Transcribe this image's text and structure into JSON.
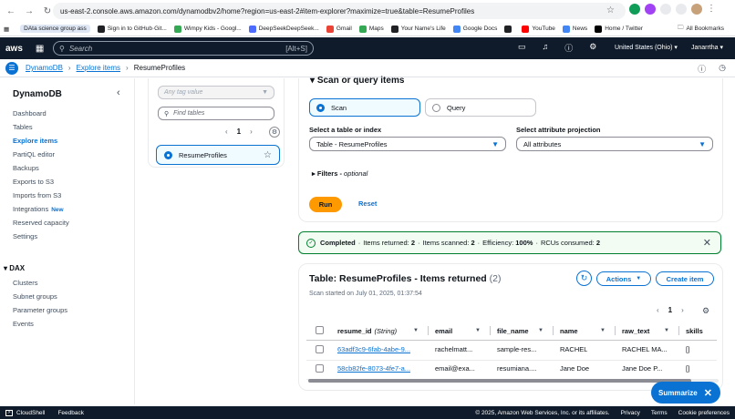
{
  "browser": {
    "url": "us-east-2.console.aws.amazon.com/dynamodbv2/home?region=us-east-2#item-explorer?maximize=true&table=ResumeProfiles",
    "bookmarks": [
      {
        "label": "DAta science group ass",
        "color": "#dfe7f5"
      },
      {
        "label": "Sign in to GitHub·Git...",
        "color": "#202124"
      },
      {
        "label": "Wimpy Kids - Googl...",
        "color": "#34a853"
      },
      {
        "label": "DeepSeekDeepSeek...",
        "color": "#4d6bfe"
      },
      {
        "label": "Gmail",
        "color": "#ea4335"
      },
      {
        "label": "Maps",
        "color": "#34a853"
      },
      {
        "label": "Your Name's Life",
        "color": "#202124"
      },
      {
        "label": "Google Docs",
        "color": "#4285f4"
      },
      {
        "label": "",
        "color": "#202124"
      },
      {
        "label": "YouTube",
        "color": "#ff0000"
      },
      {
        "label": "News",
        "color": "#4285f4"
      },
      {
        "label": "Home / Twitter",
        "color": "#000000"
      }
    ],
    "all_bookmarks": "All Bookmarks"
  },
  "awsnav": {
    "logo": "aws",
    "search_placeholder": "Search",
    "search_shortcut": "[Alt+S]",
    "region": "United States (Ohio) ▾",
    "user": "Janarrtha ▾"
  },
  "breadcrumb": {
    "items": [
      "DynamoDB",
      "Explore items",
      "ResumeProfiles"
    ]
  },
  "sidebar": {
    "title": "DynamoDB",
    "items": [
      {
        "label": "Dashboard",
        "active": false
      },
      {
        "label": "Tables",
        "active": false
      },
      {
        "label": "Explore items",
        "active": true
      },
      {
        "label": "PartiQL editor",
        "active": false
      },
      {
        "label": "Backups",
        "active": false
      },
      {
        "label": "Exports to S3",
        "active": false
      },
      {
        "label": "Imports from S3",
        "active": false
      },
      {
        "label": "Integrations",
        "active": false,
        "badge": "New"
      },
      {
        "label": "Reserved capacity",
        "active": false
      },
      {
        "label": "Settings",
        "active": false
      }
    ],
    "dax_section": "DAX",
    "dax_items": [
      "Clusters",
      "Subnet groups",
      "Parameter groups",
      "Events"
    ]
  },
  "tables_panel": {
    "tag_placeholder": "Any tag value",
    "find_placeholder": "Find tables",
    "page": "1",
    "selected_table": "ResumeProfiles"
  },
  "scan_panel": {
    "title": "Scan or query items",
    "scan_label": "Scan",
    "query_label": "Query",
    "table_label": "Select a table or index",
    "table_value": "Table - ResumeProfiles",
    "projection_label": "Select attribute projection",
    "projection_value": "All attributes",
    "filters_label": "Filters",
    "filters_optional": "optional",
    "run_label": "Run",
    "reset_label": "Reset"
  },
  "flash": {
    "status": "Completed",
    "items_returned_label": "Items returned:",
    "items_returned": "2",
    "items_scanned_label": "Items scanned:",
    "items_scanned": "2",
    "efficiency_label": "Efficiency:",
    "efficiency": "100%",
    "rcus_label": "RCUs consumed:",
    "rcus": "2"
  },
  "items_panel": {
    "title": "Table: ResumeProfiles - Items returned",
    "count": "(2)",
    "subtitle": "Scan started on July 01, 2025, 01:37:54",
    "actions_label": "Actions",
    "create_label": "Create item",
    "page": "1",
    "columns": [
      {
        "key": "resume_id",
        "type": "(String)"
      },
      {
        "key": "email",
        "type": ""
      },
      {
        "key": "file_name",
        "type": ""
      },
      {
        "key": "name",
        "type": ""
      },
      {
        "key": "raw_text",
        "type": ""
      },
      {
        "key": "skills",
        "type": ""
      }
    ],
    "rows": [
      [
        "63adf3c9-6fab-4abe-9...",
        "rachelmatt...",
        "sample-res...",
        "RACHEL",
        "RACHEL MA...",
        "[]"
      ],
      [
        "58cb82fe-8073-4fe7-a...",
        "email@exa...",
        "resumiana....",
        "Jane Doe",
        "Jane Doe P...",
        "[]"
      ]
    ]
  },
  "summarize": {
    "label": "Summarize"
  },
  "footer": {
    "cloudshell": "CloudShell",
    "feedback": "Feedback",
    "copyright": "© 2025, Amazon Web Services, Inc. or its affiliates.",
    "privacy": "Privacy",
    "terms": "Terms",
    "cookies": "Cookie preferences"
  },
  "colors": {
    "accent": "#0972d3",
    "run": "#ff9900",
    "success": "#00802f",
    "nav": "#0f1b2a"
  }
}
